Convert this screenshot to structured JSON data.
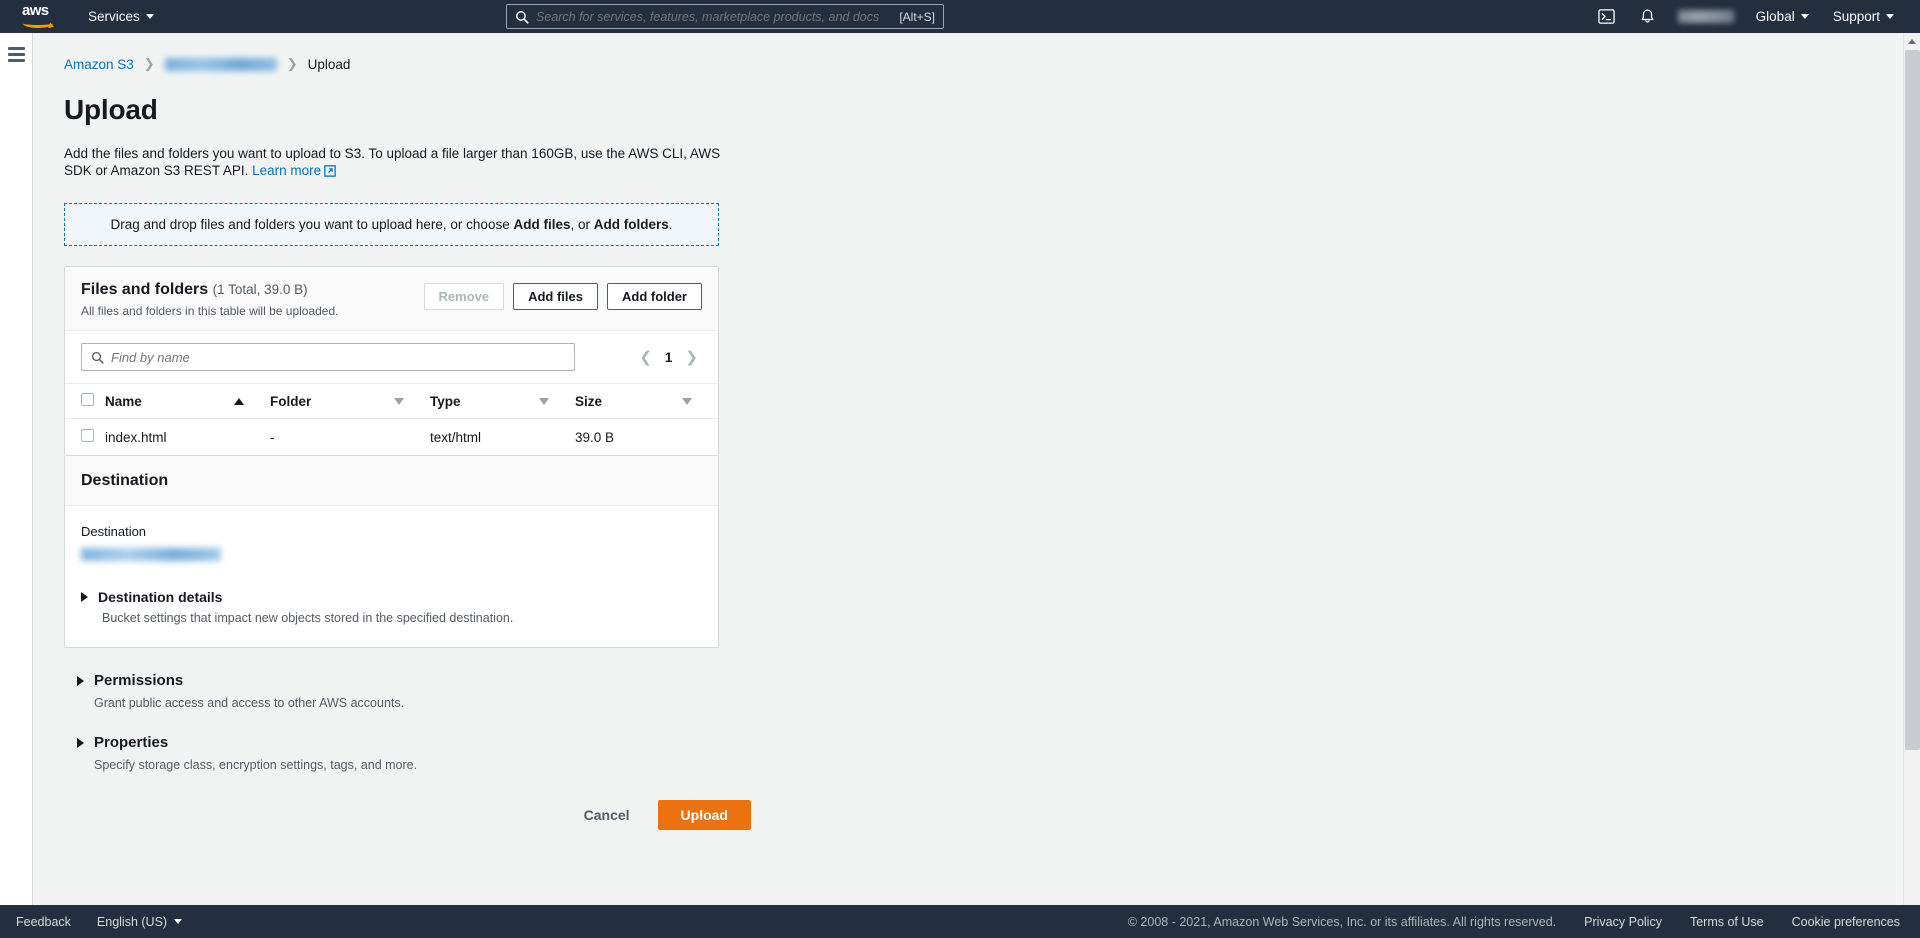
{
  "topnav": {
    "logo_alt": "aws",
    "services_label": "Services",
    "search_placeholder": "Search for services, features, marketplace products, and docs",
    "search_shortcut": "[Alt+S]",
    "search_value": "",
    "cloudshell_icon": "cloudshell-icon",
    "notifications_icon": "bell-icon",
    "account_label": "",
    "region_label": "Global",
    "support_label": "Support"
  },
  "breadcrumb": {
    "root": "Amazon S3",
    "bucket": "",
    "current": "Upload",
    "separator": "›"
  },
  "page": {
    "title": "Upload",
    "description_before_link": "Add the files and folders you want to upload to S3. To upload a file larger than 160GB, use the AWS CLI, AWS SDK or Amazon S3 REST API. ",
    "learn_more": "Learn more",
    "dropzone_text_1": "Drag and drop files and folders you want to upload here, or choose ",
    "dropzone_bold_1": "Add files",
    "dropzone_text_2": ", or ",
    "dropzone_bold_2": "Add folders",
    "dropzone_text_3": "."
  },
  "files_card": {
    "title": "Files and folders",
    "count_label": "(1 Total, 39.0 B)",
    "subtitle": "All files and folders in this table will be uploaded.",
    "remove_label": "Remove",
    "add_files_label": "Add files",
    "add_folder_label": "Add folder",
    "search_placeholder": "Find by name",
    "search_value": "",
    "page_number": "1",
    "columns": [
      {
        "label": "Name",
        "sort": "asc"
      },
      {
        "label": "Folder",
        "sort": "none"
      },
      {
        "label": "Type",
        "sort": "none"
      },
      {
        "label": "Size",
        "sort": "none"
      }
    ],
    "rows": [
      {
        "name": "index.html",
        "folder": "-",
        "type": "text/html",
        "size": "39.0 B"
      }
    ]
  },
  "destination": {
    "card_title": "Destination",
    "field_label": "Destination",
    "field_value": "",
    "details_title": "Destination details",
    "details_sub": "Bucket settings that impact new objects stored in the specified destination."
  },
  "sections": [
    {
      "title": "Permissions",
      "sub": "Grant public access and access to other AWS accounts."
    },
    {
      "title": "Properties",
      "sub": "Specify storage class, encryption settings, tags, and more."
    }
  ],
  "actions": {
    "cancel_label": "Cancel",
    "upload_label": "Upload"
  },
  "footer": {
    "feedback": "Feedback",
    "language": "English (US)",
    "copyright": "© 2008 - 2021, Amazon Web Services, Inc. or its affiliates. All rights reserved.",
    "privacy": "Privacy Policy",
    "terms": "Terms of Use",
    "cookies": "Cookie preferences"
  },
  "colors": {
    "nav_bg": "#232f3e",
    "accent_orange": "#ec7211",
    "link_blue": "#0073bb",
    "page_bg": "#f1f3f3"
  }
}
